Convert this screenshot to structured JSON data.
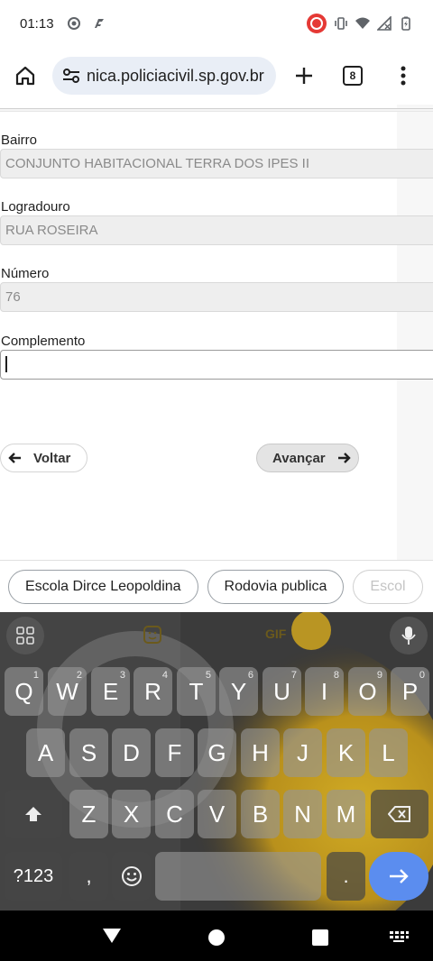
{
  "status_bar": {
    "time": "01:13"
  },
  "browser": {
    "url": "nica.policiacivil.sp.gov.br",
    "tab_count": "8"
  },
  "form": {
    "bairro": {
      "label": "Bairro",
      "value": "CONJUNTO HABITACIONAL TERRA DOS IPES II"
    },
    "logradouro": {
      "label": "Logradouro",
      "value": "RUA ROSEIRA"
    },
    "numero": {
      "label": "Número",
      "value": "76"
    },
    "complemento": {
      "label": "Complemento",
      "value": ""
    },
    "back_label": "Voltar",
    "next_label": "Avançar"
  },
  "suggestions": [
    "Escola Dirce Leopoldina",
    "Rodovia publica",
    "Escol"
  ],
  "keyboard": {
    "gif_label": "GIF",
    "row1": [
      {
        "k": "Q",
        "h": "1"
      },
      {
        "k": "W",
        "h": "2"
      },
      {
        "k": "E",
        "h": "3"
      },
      {
        "k": "R",
        "h": "4"
      },
      {
        "k": "T",
        "h": "5"
      },
      {
        "k": "Y",
        "h": "6"
      },
      {
        "k": "U",
        "h": "7"
      },
      {
        "k": "I",
        "h": "8"
      },
      {
        "k": "O",
        "h": "9"
      },
      {
        "k": "P",
        "h": "0"
      }
    ],
    "row2": [
      "A",
      "S",
      "D",
      "F",
      "G",
      "H",
      "J",
      "K",
      "L"
    ],
    "row3": [
      "Z",
      "X",
      "C",
      "V",
      "B",
      "N",
      "M"
    ],
    "symbols_label": "?123",
    "comma": ",",
    "period": "."
  }
}
